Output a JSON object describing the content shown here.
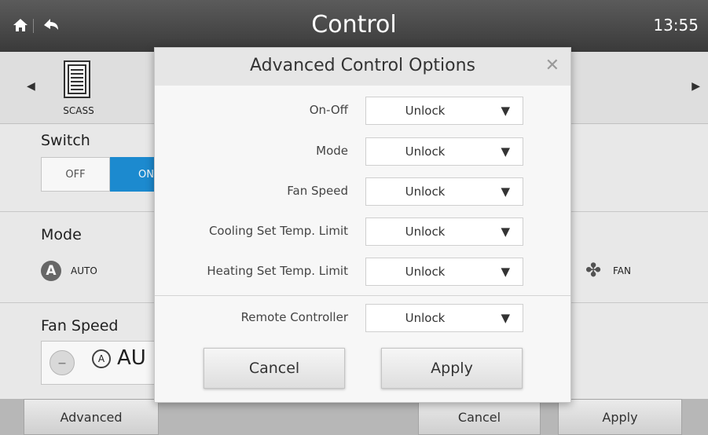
{
  "header": {
    "title": "Control",
    "time": "13:55",
    "home_icon": "home-icon",
    "back_icon": "back-icon"
  },
  "unit": {
    "label": "SCASS"
  },
  "switch": {
    "title": "Switch",
    "off_label": "OFF",
    "on_label": "ON"
  },
  "mode": {
    "title": "Mode",
    "auto_label": "AUTO",
    "auto_glyph": "A",
    "fan_label": "FAN"
  },
  "fan_speed": {
    "title": "Fan Speed",
    "value": "AU",
    "auto_glyph": "A"
  },
  "bottom": {
    "advanced_label": "Advanced",
    "cancel_label": "Cancel",
    "apply_label": "Apply"
  },
  "dialog": {
    "title": "Advanced Control Options",
    "rows": [
      {
        "label": "On-Off",
        "value": "Unlock"
      },
      {
        "label": "Mode",
        "value": "Unlock"
      },
      {
        "label": "Fan Speed",
        "value": "Unlock"
      },
      {
        "label": "Cooling Set Temp. Limit",
        "value": "Unlock"
      },
      {
        "label": "Heating Set Temp. Limit",
        "value": "Unlock"
      },
      {
        "label": "Remote Controller",
        "value": "Unlock"
      }
    ],
    "cancel_label": "Cancel",
    "apply_label": "Apply"
  },
  "colors": {
    "accent": "#1d8fd6",
    "topbar": "#4a4a4a"
  }
}
